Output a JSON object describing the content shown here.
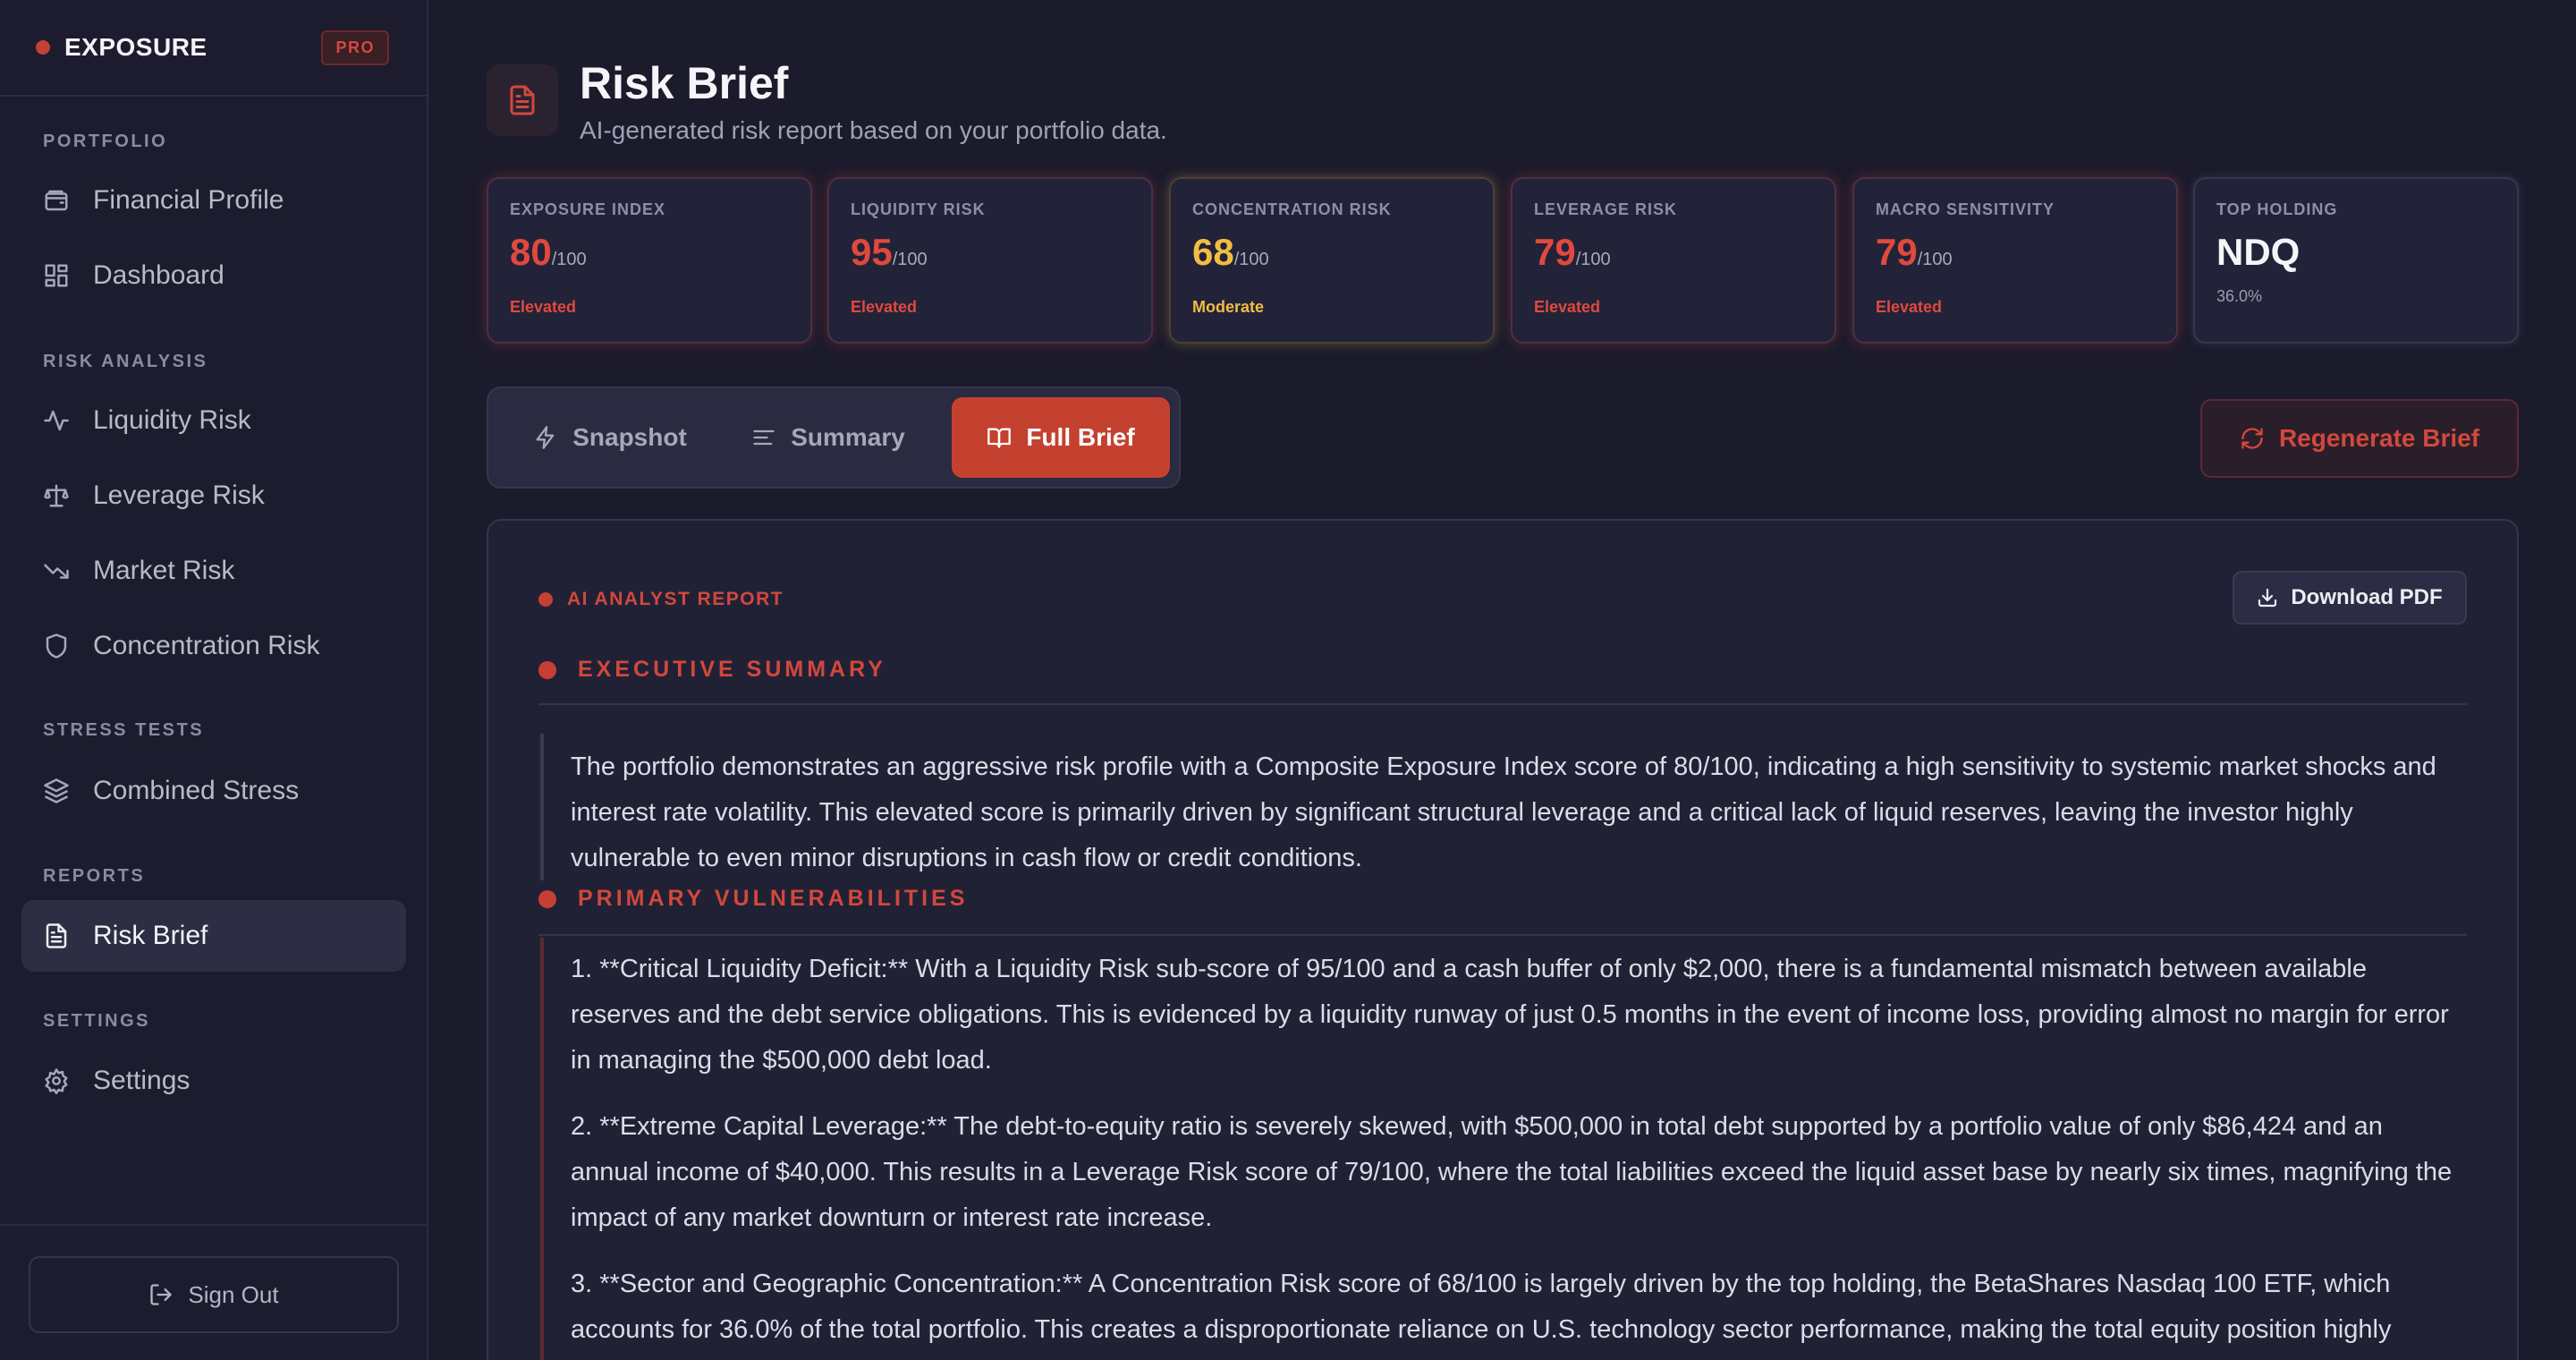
{
  "brand": {
    "name": "EXPOSURE",
    "badge": "PRO"
  },
  "sidebar": {
    "sections": [
      {
        "label": "PORTFOLIO"
      },
      {
        "label": "RISK ANALYSIS"
      },
      {
        "label": "STRESS TESTS"
      },
      {
        "label": "REPORTS"
      },
      {
        "label": "SETTINGS"
      }
    ],
    "items": [
      {
        "label": "Financial Profile",
        "icon": "wallet-icon"
      },
      {
        "label": "Dashboard",
        "icon": "grid-icon"
      },
      {
        "label": "Liquidity Risk",
        "icon": "activity-icon"
      },
      {
        "label": "Leverage Risk",
        "icon": "scale-icon"
      },
      {
        "label": "Market Risk",
        "icon": "trending-down-icon"
      },
      {
        "label": "Concentration Risk",
        "icon": "shield-icon"
      },
      {
        "label": "Combined Stress",
        "icon": "layers-icon"
      },
      {
        "label": "Risk Brief",
        "icon": "file-text-icon",
        "active": true
      },
      {
        "label": "Settings",
        "icon": "gear-icon"
      }
    ],
    "signout": "Sign Out"
  },
  "header": {
    "title": "Risk Brief",
    "subtitle": "AI-generated risk report based on your portfolio data."
  },
  "metrics": [
    {
      "label": "EXPOSURE INDEX",
      "value": "80",
      "denom": "/100",
      "status": "Elevated",
      "tone": "red"
    },
    {
      "label": "LIQUIDITY RISK",
      "value": "95",
      "denom": "/100",
      "status": "Elevated",
      "tone": "red"
    },
    {
      "label": "CONCENTRATION RISK",
      "value": "68",
      "denom": "/100",
      "status": "Moderate",
      "tone": "amber"
    },
    {
      "label": "LEVERAGE RISK",
      "value": "79",
      "denom": "/100",
      "status": "Elevated",
      "tone": "red"
    },
    {
      "label": "MACRO SENSITIVITY",
      "value": "79",
      "denom": "/100",
      "status": "Elevated",
      "tone": "red"
    },
    {
      "label": "TOP HOLDING",
      "value": "NDQ",
      "denom": "",
      "status": "36.0%",
      "tone": "neutral"
    }
  ],
  "tabs": [
    {
      "label": "Snapshot",
      "icon": "zap-icon"
    },
    {
      "label": "Summary",
      "icon": "align-left-icon"
    },
    {
      "label": "Full Brief",
      "icon": "book-open-icon",
      "active": true
    }
  ],
  "regenerate_label": "Regenerate Brief",
  "report": {
    "tag": "AI ANALYST REPORT",
    "download_label": "Download PDF",
    "sections": [
      {
        "heading": "EXECUTIVE SUMMARY",
        "paragraphs": [
          "The portfolio demonstrates an aggressive risk profile with a Composite Exposure Index score of 80/100, indicating a high sensitivity to systemic market shocks and interest rate volatility. This elevated score is primarily driven by significant structural leverage and a critical lack of liquid reserves, leaving the investor highly vulnerable to even minor disruptions in cash flow or credit conditions."
        ]
      },
      {
        "heading": "PRIMARY VULNERABILITIES",
        "paragraphs": [
          "1. **Critical Liquidity Deficit:** With a Liquidity Risk sub-score of 95/100 and a cash buffer of only $2,000, there is a fundamental mismatch between available reserves and the debt service obligations. This is evidenced by a liquidity runway of just 0.5 months in the event of income loss, providing almost no margin for error in managing the $500,000 debt load.",
          "2. **Extreme Capital Leverage:** The debt-to-equity ratio is severely skewed, with $500,000 in total debt supported by a portfolio value of only $86,424 and an annual income of $40,000. This results in a Leverage Risk score of 79/100, where the total liabilities exceed the liquid asset base by nearly six times, magnifying the impact of any market downturn or interest rate increase.",
          "3. **Sector and Geographic Concentration:** A Concentration Risk score of 68/100 is largely driven by the top holding, the BetaShares Nasdaq 100 ETF, which accounts for 36.0% of the total portfolio. This creates a disproportionate reliance on U.S. technology sector performance, making the total equity position highly"
        ]
      }
    ]
  },
  "colors": {
    "accent": "#c4412f",
    "elevated": "#e0493d",
    "moderate": "#f2bd45",
    "background": "#1b1b2c"
  }
}
